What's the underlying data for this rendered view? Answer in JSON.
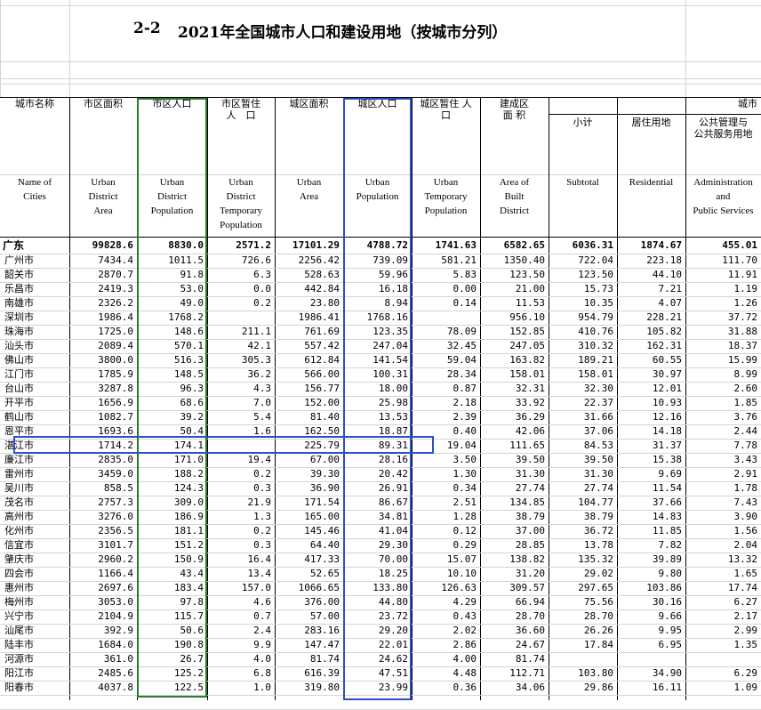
{
  "title": {
    "code": "2-2",
    "text": "2021年全国城市人口和建设用地（按城市分列）"
  },
  "headers_cn": [
    "城市名称",
    "市区面积",
    "市区人口",
    "市区暂住\n人　口",
    "城区面积",
    "城区人口",
    "城区暂住 人\n口",
    "建成区\n面 积",
    "小计",
    "居住用地",
    "公共管理与\n公共服务用地"
  ],
  "group_header_cn": "城市",
  "headers_en": [
    "Name of\nCities",
    "Urban\nDistrict\nArea",
    "Urban\nDistrict\nPopulation",
    "Urban\nDistrict\nTemporary\nPopulation",
    "Urban\nArea",
    "Urban\nPopulation",
    "Urban\nTemporary\nPopulation",
    "Area of\nBuilt\nDistrict",
    "Subtotal",
    "Residential",
    "Administration\nand\nPublic Services"
  ],
  "province": {
    "name": "广东",
    "values": [
      "99828.6",
      "8830.0",
      "2571.2",
      "17101.29",
      "4788.72",
      "1741.63",
      "6582.65",
      "6036.31",
      "1874.67",
      "455.01"
    ]
  },
  "rows": [
    {
      "name": "广州市",
      "values": [
        "7434.4",
        "1011.5",
        "726.6",
        "2256.42",
        "739.09",
        "581.21",
        "1350.40",
        "722.04",
        "223.18",
        "111.70"
      ]
    },
    {
      "name": "韶关市",
      "values": [
        "2870.7",
        "91.8",
        "6.3",
        "528.63",
        "59.96",
        "5.83",
        "123.50",
        "123.50",
        "44.10",
        "11.91"
      ]
    },
    {
      "name": "乐昌市",
      "values": [
        "2419.3",
        "53.0",
        "0.0",
        "442.84",
        "16.18",
        "0.00",
        "21.00",
        "15.73",
        "7.21",
        "1.19"
      ]
    },
    {
      "name": "南雄市",
      "values": [
        "2326.2",
        "49.0",
        "0.2",
        "23.80",
        "8.94",
        "0.14",
        "11.53",
        "10.35",
        "4.07",
        "1.26"
      ]
    },
    {
      "name": "深圳市",
      "values": [
        "1986.4",
        "1768.2",
        "",
        "1986.41",
        "1768.16",
        "",
        "956.10",
        "954.79",
        "228.21",
        "37.72"
      ]
    },
    {
      "name": "珠海市",
      "values": [
        "1725.0",
        "148.6",
        "211.1",
        "761.69",
        "123.35",
        "78.09",
        "152.85",
        "410.76",
        "105.82",
        "31.88"
      ]
    },
    {
      "name": "汕头市",
      "values": [
        "2089.4",
        "570.1",
        "42.1",
        "557.42",
        "247.04",
        "32.45",
        "247.05",
        "310.32",
        "162.31",
        "18.37"
      ]
    },
    {
      "name": "佛山市",
      "values": [
        "3800.0",
        "516.3",
        "305.3",
        "612.84",
        "141.54",
        "59.04",
        "163.82",
        "189.21",
        "60.55",
        "15.99"
      ]
    },
    {
      "name": "江门市",
      "values": [
        "1785.9",
        "148.5",
        "36.2",
        "566.00",
        "100.31",
        "28.34",
        "158.01",
        "158.01",
        "30.97",
        "8.99"
      ]
    },
    {
      "name": "台山市",
      "values": [
        "3287.8",
        "96.3",
        "4.3",
        "156.77",
        "18.00",
        "0.87",
        "32.31",
        "32.30",
        "12.01",
        "2.60"
      ]
    },
    {
      "name": "开平市",
      "values": [
        "1656.9",
        "68.6",
        "7.0",
        "152.00",
        "25.98",
        "2.18",
        "33.92",
        "22.37",
        "10.93",
        "1.85"
      ]
    },
    {
      "name": "鹤山市",
      "values": [
        "1082.7",
        "39.2",
        "5.4",
        "81.40",
        "13.53",
        "2.39",
        "36.29",
        "31.66",
        "12.16",
        "3.76"
      ]
    },
    {
      "name": "恩平市",
      "values": [
        "1693.6",
        "50.4",
        "1.6",
        "162.50",
        "18.87",
        "0.40",
        "42.06",
        "37.06",
        "14.18",
        "2.44"
      ]
    },
    {
      "name": "湛江市",
      "values": [
        "1714.2",
        "174.1",
        "",
        "225.79",
        "89.31",
        "19.04",
        "111.65",
        "84.53",
        "31.37",
        "7.78"
      ]
    },
    {
      "name": "廉江市",
      "values": [
        "2835.0",
        "171.0",
        "19.4",
        "67.00",
        "28.16",
        "3.50",
        "39.50",
        "39.50",
        "15.38",
        "3.43"
      ]
    },
    {
      "name": "雷州市",
      "values": [
        "3459.0",
        "188.2",
        "0.2",
        "39.30",
        "20.42",
        "1.30",
        "31.30",
        "31.30",
        "9.69",
        "2.91"
      ]
    },
    {
      "name": "吴川市",
      "values": [
        "858.5",
        "124.3",
        "0.3",
        "36.90",
        "26.91",
        "0.34",
        "27.74",
        "27.74",
        "11.54",
        "1.78"
      ]
    },
    {
      "name": "茂名市",
      "values": [
        "2757.3",
        "309.0",
        "21.9",
        "171.54",
        "86.67",
        "2.51",
        "134.85",
        "104.77",
        "37.66",
        "7.43"
      ]
    },
    {
      "name": "高州市",
      "values": [
        "3276.0",
        "186.9",
        "1.3",
        "165.00",
        "34.81",
        "1.28",
        "38.79",
        "38.79",
        "14.83",
        "3.90"
      ]
    },
    {
      "name": "化州市",
      "values": [
        "2356.5",
        "181.1",
        "0.2",
        "145.46",
        "41.04",
        "0.12",
        "37.00",
        "36.72",
        "11.85",
        "1.56"
      ]
    },
    {
      "name": "信宜市",
      "values": [
        "3101.7",
        "151.2",
        "0.3",
        "64.40",
        "29.30",
        "0.29",
        "28.85",
        "13.78",
        "7.82",
        "2.04"
      ]
    },
    {
      "name": "肇庆市",
      "values": [
        "2960.2",
        "150.9",
        "16.4",
        "417.33",
        "70.00",
        "15.07",
        "138.82",
        "135.32",
        "39.89",
        "13.32"
      ]
    },
    {
      "name": "四会市",
      "values": [
        "1166.4",
        "43.4",
        "13.4",
        "52.65",
        "18.25",
        "10.10",
        "31.20",
        "29.02",
        "9.80",
        "1.65"
      ]
    },
    {
      "name": "惠州市",
      "values": [
        "2697.6",
        "183.4",
        "157.0",
        "1066.65",
        "133.80",
        "126.63",
        "309.57",
        "297.65",
        "103.86",
        "17.74"
      ]
    },
    {
      "name": "梅州市",
      "values": [
        "3053.0",
        "97.8",
        "4.6",
        "376.00",
        "44.80",
        "4.29",
        "66.94",
        "75.56",
        "30.16",
        "6.27"
      ]
    },
    {
      "name": "兴宁市",
      "values": [
        "2104.9",
        "115.7",
        "0.7",
        "57.00",
        "23.72",
        "0.43",
        "28.70",
        "28.70",
        "9.66",
        "2.17"
      ]
    },
    {
      "name": "汕尾市",
      "values": [
        "392.9",
        "50.6",
        "2.4",
        "283.16",
        "29.20",
        "2.02",
        "36.60",
        "26.26",
        "9.95",
        "2.99"
      ]
    },
    {
      "name": "陆丰市",
      "values": [
        "1684.0",
        "190.8",
        "9.9",
        "147.47",
        "22.01",
        "2.86",
        "24.67",
        "17.84",
        "6.95",
        "1.35"
      ]
    },
    {
      "name": "河源市",
      "values": [
        "361.0",
        "26.7",
        "4.0",
        "81.74",
        "24.62",
        "4.00",
        "81.74",
        "",
        "",
        ""
      ]
    },
    {
      "name": "阳江市",
      "values": [
        "2485.6",
        "125.2",
        "6.8",
        "616.39",
        "47.51",
        "4.48",
        "112.71",
        "103.80",
        "34.90",
        "6.29"
      ]
    },
    {
      "name": "阳春市",
      "values": [
        "4037.8",
        "122.5",
        "1.0",
        "319.80",
        "23.99",
        "0.36",
        "34.06",
        "29.86",
        "16.11",
        "1.09"
      ]
    }
  ],
  "colors": {
    "green_box": "#2a7a2a",
    "blue_box": "#2e4fc2"
  }
}
